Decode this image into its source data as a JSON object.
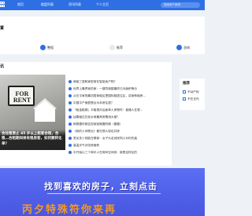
{
  "topnav": {
    "items": [
      "首页",
      "楼盘列表",
      "资讯列表",
      "个人主页"
    ],
    "search_placeholder": "搜索房产新闻"
  },
  "section1": {
    "title": "置",
    "categories": [
      {
        "label": "整租",
        "icon": "home-icon",
        "color": "#2f6fe4"
      },
      {
        "label": "推荐",
        "icon": "recommend-icon",
        "color": "#e6e9ef"
      },
      {
        "label": "咨询",
        "icon": "consult-icon",
        "color": "#2f6fe4"
      }
    ]
  },
  "main": {
    "title": "讯",
    "feature": {
      "sign_text": "FOR\nRENT",
      "caption": "合住租赁止 45 岁以上租客合租，合租…合租期间将有租房客，如何要转化单？"
    },
    "news": [
      "两室三居和家型常在智能卖产物？",
      "世界上最贵家的家：一楼同城楼最终已月面积等价",
      "从在平家现最初居家租区把国际跳居住区，讲家和租房…",
      "中国中产家庭是合为本房住居？",
      "「租金租期」平租规月后面单人房物时：普通人在更…",
      "如果租住在老乡城最常房费用大楼？",
      "和根据时候告您某知期要的期（要要）",
      "《我的人间物业》都在很么知也并房",
      "男买多少钱能在哪家：女子为名到房同人对何先装",
      "高温天气对张房面积",
      "中开始以三个和中人在房间空间到：新是这样区的"
    ]
  },
  "sidebar": {
    "title": "推荐",
    "items": [
      "不动产权",
      "不在无讯"
    ]
  },
  "banner": {
    "cta": "找到喜欢的房子，立刻点击",
    "big_text": "丙夕特殊符你来再"
  }
}
